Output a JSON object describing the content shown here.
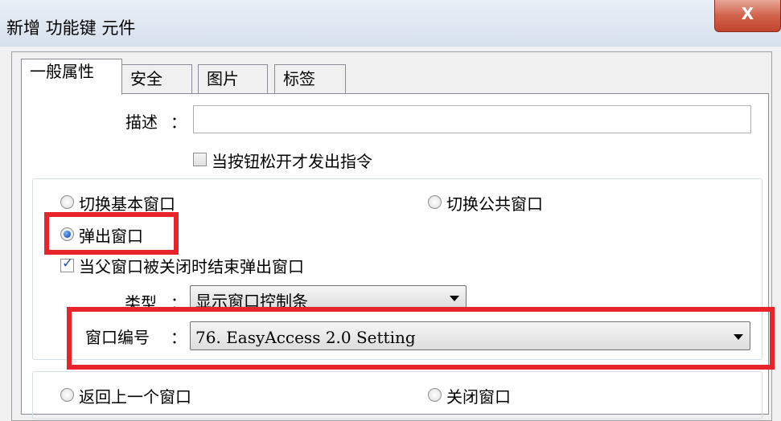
{
  "window": {
    "title": "新增 功能键 元件",
    "close_glyph": "X"
  },
  "tabs": [
    {
      "label": "一般属性",
      "active": true
    },
    {
      "label": "安全",
      "active": false
    },
    {
      "label": "图片",
      "active": false
    },
    {
      "label": "标签",
      "active": false
    }
  ],
  "form": {
    "description_label": "描述",
    "colon": "：",
    "description_value": "",
    "release_checkbox_label": "当按钮松开才发出指令",
    "release_checkbox_checked": false
  },
  "actions": {
    "switch_base_window": "切换基本窗口",
    "switch_common_window": "切换公共窗口",
    "popup_window": "弹出窗口",
    "popup_selected": true,
    "close_with_parent_label": "当父窗口被关闭时结束弹出窗口",
    "close_with_parent_checked": true,
    "type_label": "类型",
    "type_value": "显示窗口控制条",
    "window_no_label": "窗口编号",
    "window_no_value": "76. EasyAccess 2.0 Setting",
    "return_prev_window": "返回上一个窗口",
    "close_window": "关闭窗口"
  },
  "colors": {
    "highlight": "#e8242b",
    "close_button": "#c2452c",
    "checkmark": "#2a58a8"
  }
}
